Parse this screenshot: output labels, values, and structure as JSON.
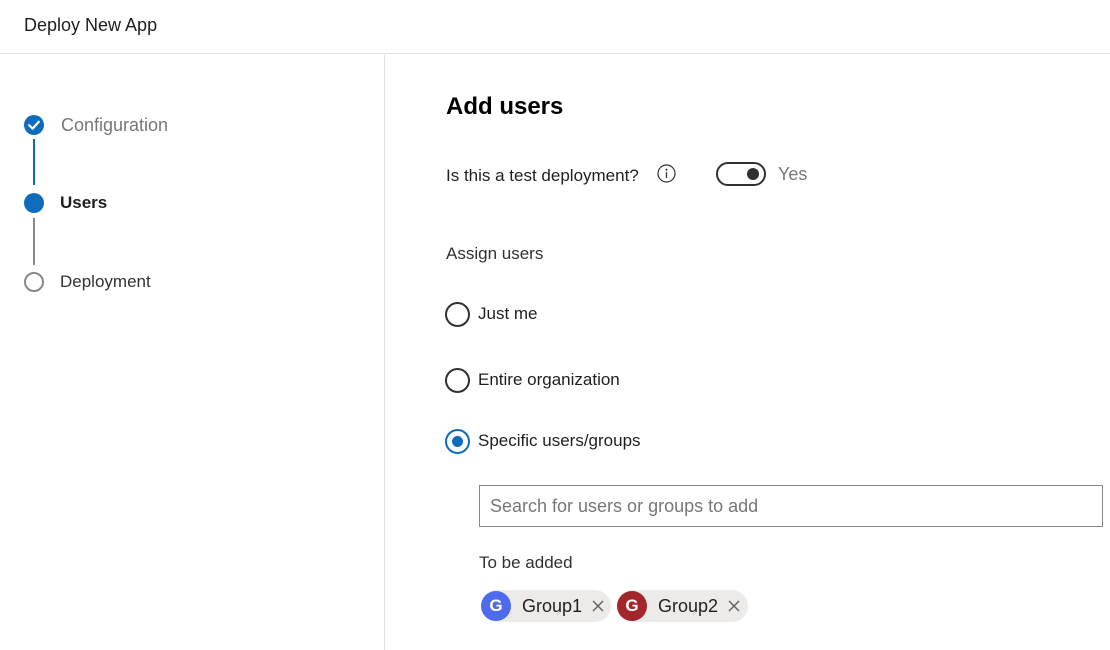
{
  "header": {
    "title": "Deploy New App"
  },
  "steps": [
    {
      "label": "Configuration",
      "state": "done"
    },
    {
      "label": "Users",
      "state": "current"
    },
    {
      "label": "Deployment",
      "state": "pending"
    }
  ],
  "main": {
    "title": "Add users",
    "test_deployment": {
      "label": "Is this a test deployment?",
      "toggle_text": "Yes",
      "toggle_on": true
    },
    "assign": {
      "label": "Assign users",
      "options": [
        {
          "label": "Just me",
          "checked": false
        },
        {
          "label": "Entire organization",
          "checked": false
        },
        {
          "label": "Specific users/groups",
          "checked": true
        }
      ]
    },
    "search": {
      "placeholder": "Search for users or groups to add",
      "value": ""
    },
    "to_be_added": {
      "label": "To be added",
      "chips": [
        {
          "initial": "G",
          "name": "Group1",
          "color": "#4f6bed"
        },
        {
          "initial": "G",
          "name": "Group2",
          "color": "#a4262c"
        }
      ]
    }
  },
  "colors": {
    "accent": "#0f6cbd",
    "border": "#e1dfdd",
    "muted_text": "#797775"
  }
}
